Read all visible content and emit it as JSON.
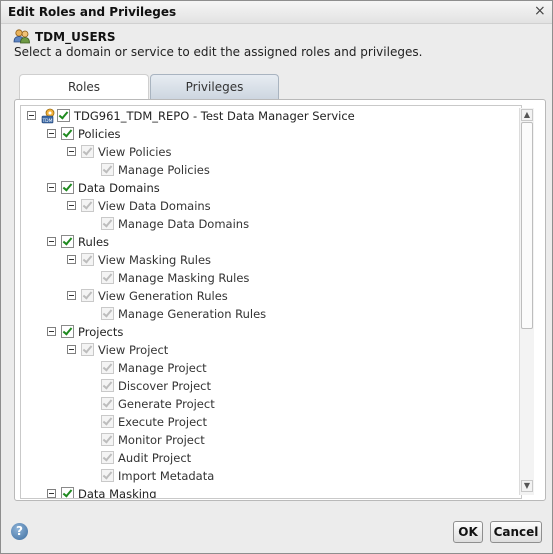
{
  "window": {
    "title": "Edit Roles and Privileges"
  },
  "header": {
    "user": "TDM_USERS",
    "description": "Select a domain or service to edit the assigned roles and privileges."
  },
  "tabs": [
    {
      "label": "Roles",
      "active": false
    },
    {
      "label": "Privileges",
      "active": true
    }
  ],
  "tree": [
    {
      "label": "TDG961_TDM_REPO - Test Data Manager Service",
      "type": "service",
      "checked": true,
      "enabled": true
    },
    {
      "label": "Policies",
      "checked": true,
      "enabled": true
    },
    {
      "label": "View Policies",
      "checked": true,
      "enabled": false
    },
    {
      "label": "Manage Policies",
      "checked": true,
      "enabled": false
    },
    {
      "label": "Data Domains",
      "checked": true,
      "enabled": true
    },
    {
      "label": "View Data Domains",
      "checked": true,
      "enabled": false
    },
    {
      "label": "Manage Data Domains",
      "checked": true,
      "enabled": false
    },
    {
      "label": "Rules",
      "checked": true,
      "enabled": true
    },
    {
      "label": "View Masking Rules",
      "checked": true,
      "enabled": false
    },
    {
      "label": "Manage Masking Rules",
      "checked": true,
      "enabled": false
    },
    {
      "label": "View Generation Rules",
      "checked": true,
      "enabled": false
    },
    {
      "label": "Manage Generation Rules",
      "checked": true,
      "enabled": false
    },
    {
      "label": "Projects",
      "checked": true,
      "enabled": true
    },
    {
      "label": "View Project",
      "checked": true,
      "enabled": false
    },
    {
      "label": "Manage Project",
      "checked": true,
      "enabled": false
    },
    {
      "label": "Discover Project",
      "checked": true,
      "enabled": false
    },
    {
      "label": "Generate Project",
      "checked": true,
      "enabled": false
    },
    {
      "label": "Execute Project",
      "checked": true,
      "enabled": false
    },
    {
      "label": "Monitor Project",
      "checked": true,
      "enabled": false
    },
    {
      "label": "Audit Project",
      "checked": true,
      "enabled": false
    },
    {
      "label": "Import Metadata",
      "checked": true,
      "enabled": false
    },
    {
      "label": "Data Masking",
      "checked": true,
      "enabled": true
    }
  ],
  "footer": {
    "help_icon": "help-icon",
    "ok_label": "OK",
    "cancel_label": "Cancel"
  },
  "colors": {
    "check": "#1f8a1f",
    "tab_active": "#cdd6e0"
  }
}
